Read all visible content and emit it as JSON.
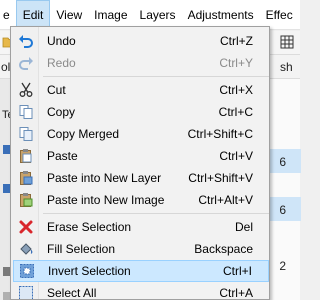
{
  "menubar": {
    "items": [
      {
        "label": "e"
      },
      {
        "label": "Edit",
        "active": true
      },
      {
        "label": "View"
      },
      {
        "label": "Image"
      },
      {
        "label": "Layers"
      },
      {
        "label": "Adjustments"
      },
      {
        "label": "Effec"
      }
    ]
  },
  "background": {
    "toolbar_label": "ol:",
    "right_fragment": "sh",
    "tab_fragment": "Te",
    "numbers": [
      "6",
      "6",
      "2"
    ]
  },
  "edit_menu": {
    "items": [
      {
        "label": "Undo",
        "shortcut": "Ctrl+Z",
        "icon": "undo-icon",
        "disabled": false
      },
      {
        "label": "Redo",
        "shortcut": "Ctrl+Y",
        "icon": "redo-icon",
        "disabled": true
      },
      {
        "label": "Cut",
        "shortcut": "Ctrl+X",
        "icon": "scissors-icon",
        "disabled": false
      },
      {
        "label": "Copy",
        "shortcut": "Ctrl+C",
        "icon": "copy-icon",
        "disabled": false
      },
      {
        "label": "Copy Merged",
        "shortcut": "Ctrl+Shift+C",
        "icon": "copy-merged-icon",
        "disabled": false
      },
      {
        "label": "Paste",
        "shortcut": "Ctrl+V",
        "icon": "paste-icon",
        "disabled": false
      },
      {
        "label": "Paste into New Layer",
        "shortcut": "Ctrl+Shift+V",
        "icon": "paste-new-layer-icon",
        "disabled": false
      },
      {
        "label": "Paste into New Image",
        "shortcut": "Ctrl+Alt+V",
        "icon": "paste-new-image-icon",
        "disabled": false
      },
      {
        "label": "Erase Selection",
        "shortcut": "Del",
        "icon": "erase-x-icon",
        "disabled": false
      },
      {
        "label": "Fill Selection",
        "shortcut": "Backspace",
        "icon": "fill-bucket-icon",
        "disabled": false
      },
      {
        "label": "Invert Selection",
        "shortcut": "Ctrl+I",
        "icon": "invert-selection-icon",
        "disabled": false,
        "highlighted": true
      },
      {
        "label": "Select All",
        "shortcut": "Ctrl+A",
        "icon": "select-all-icon",
        "disabled": false
      }
    ]
  },
  "colors": {
    "accent": "#1e78d6",
    "highlight": "#cce8ff",
    "erase_red": "#d9262c"
  }
}
